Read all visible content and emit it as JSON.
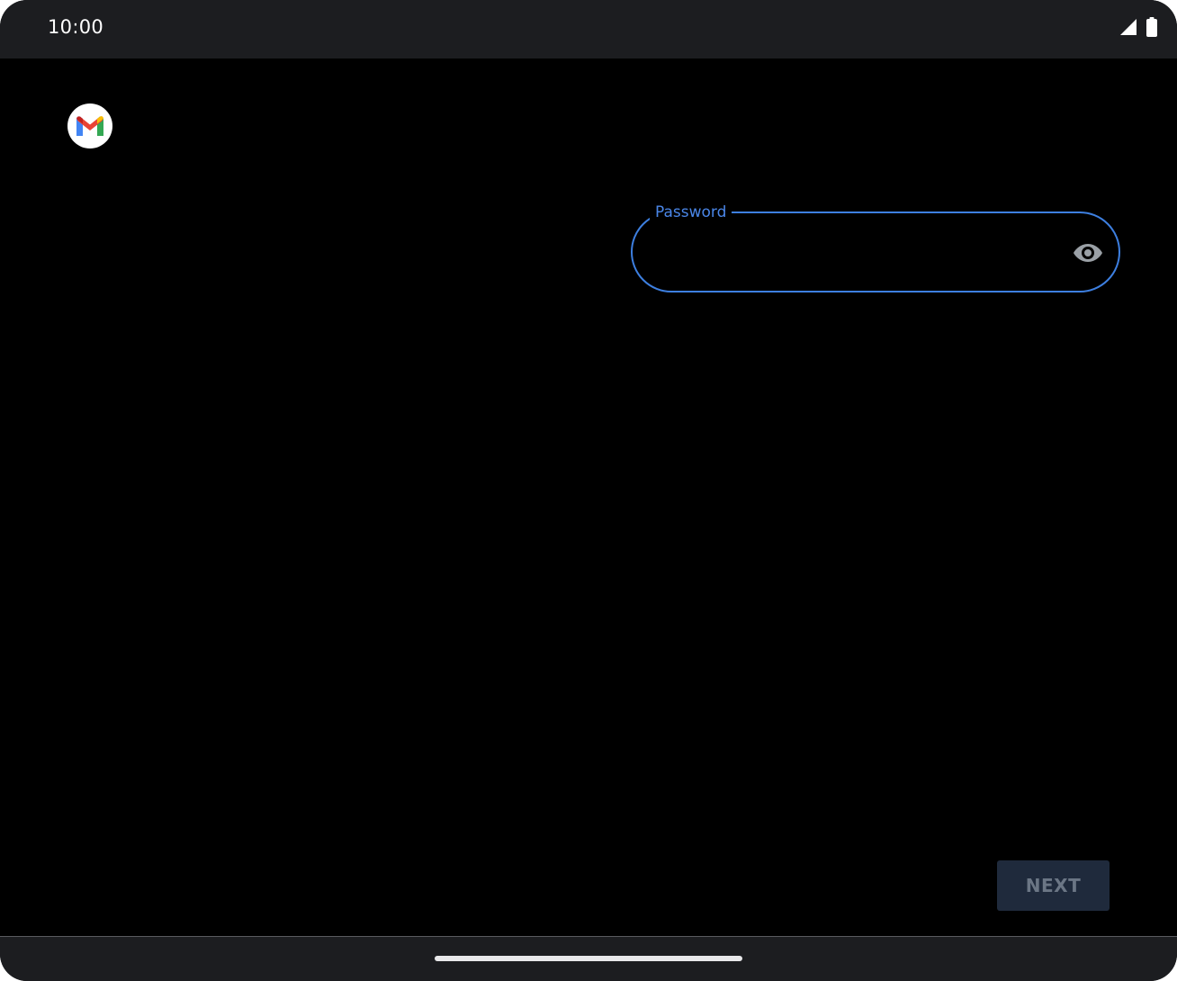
{
  "status_bar": {
    "time": "10:00",
    "icons": [
      "cellular-signal-icon",
      "battery-icon"
    ]
  },
  "app": {
    "logo": "gmail-logo-icon",
    "colors": {
      "red": "#ea4335",
      "blue": "#4285f4",
      "green": "#34a853",
      "yellow": "#fbbc04"
    }
  },
  "password_field": {
    "label": "Password",
    "value": "",
    "toggle_icon": "eye-icon",
    "accent_color": "#3d7fe0"
  },
  "actions": {
    "next_label": "NEXT"
  },
  "navigation": {
    "handle": "home-gesture-handle"
  }
}
